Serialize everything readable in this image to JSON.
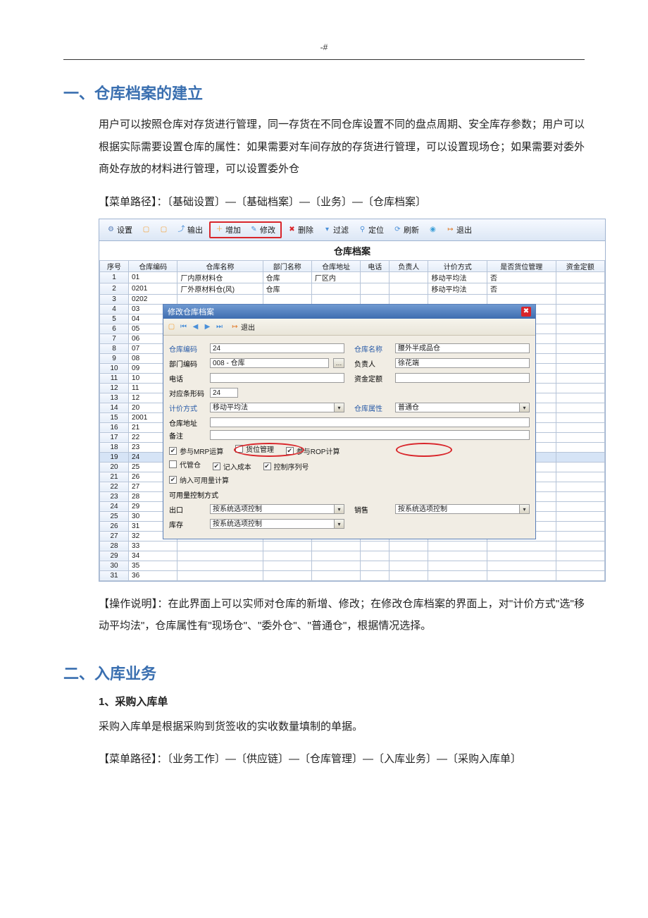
{
  "page_mark": "-#",
  "heading1": "一、仓库档案的建立",
  "para1": "用户可以按照仓库对存货进行管理，同一存货在不同仓库设置不同的盘点周期、安全库存参数；用户可以根据实际需要设置仓库的属性：如果需要对车间存放的存货进行管理，可以设置现场仓；如果需要对委外商处存放的材料进行管理，可以设置委外仓",
  "menu_path1": "【菜单路径】：〔基础设置〕—〔基础档案〕—〔业务〕—〔仓库档案〕",
  "op_note": "【操作说明】：在此界面上可以实师对仓库的新增、修改；在修改仓库档案的界面上，对\"计价方式\"选\"移动平均法\"，仓库属性有\"现场仓\"、\"委外仓\"、\"普通仓\"，根据情况选择。",
  "heading2": "二、入库业务",
  "sub2_1": "1、采购入库单",
  "para2": "采购入库单是根据采购到货签收的实收数量填制的单据。",
  "menu_path2": "【菜单路径】：〔业务工作〕—〔供应链〕—〔仓库管理〕—〔入库业务〕—〔采购入库单〕",
  "shot": {
    "toolbar": {
      "settings": "设置",
      "blank1": "",
      "blank2": "",
      "output": "输出",
      "add": "增加",
      "modify": "修改",
      "delete": "删除",
      "filter": "过滤",
      "locate": "定位",
      "refresh": "刷新",
      "ok": "",
      "exit": "退出"
    },
    "title": "仓库档案",
    "cols": [
      "序号",
      "仓库编码",
      "仓库名称",
      "部门名称",
      "仓库地址",
      "电话",
      "负责人",
      "计价方式",
      "是否货位管理",
      "资金定额"
    ],
    "rows": [
      [
        "1",
        "01",
        "厂内原材料仓",
        "仓库",
        "厂区内",
        "",
        "",
        "移动平均法",
        "否",
        ""
      ],
      [
        "2",
        "0201",
        "厂外原材料仓(风)",
        "仓库",
        "",
        "",
        "",
        "移动平均法",
        "否",
        ""
      ],
      [
        "3",
        "0202",
        "",
        "",
        "",
        "",
        "",
        "",
        "",
        ""
      ],
      [
        "4",
        "03",
        "",
        "",
        "",
        "",
        "",
        "",
        "",
        ""
      ],
      [
        "5",
        "04",
        "",
        "",
        "",
        "",
        "",
        "",
        "",
        ""
      ],
      [
        "6",
        "05",
        "",
        "",
        "",
        "",
        "",
        "",
        "",
        ""
      ],
      [
        "7",
        "06",
        "",
        "",
        "",
        "",
        "",
        "",
        "",
        ""
      ],
      [
        "8",
        "07",
        "",
        "",
        "",
        "",
        "",
        "",
        "",
        ""
      ],
      [
        "9",
        "08",
        "",
        "",
        "",
        "",
        "",
        "",
        "",
        ""
      ],
      [
        "10",
        "09",
        "",
        "",
        "",
        "",
        "",
        "",
        "",
        ""
      ],
      [
        "11",
        "10",
        "",
        "",
        "",
        "",
        "",
        "",
        "",
        ""
      ],
      [
        "12",
        "11",
        "",
        "",
        "",
        "",
        "",
        "",
        "",
        ""
      ],
      [
        "13",
        "12",
        "",
        "",
        "",
        "",
        "",
        "",
        "",
        ""
      ],
      [
        "14",
        "20",
        "",
        "",
        "",
        "",
        "",
        "",
        "",
        ""
      ],
      [
        "15",
        "2001",
        "",
        "",
        "",
        "",
        "",
        "",
        "",
        ""
      ],
      [
        "16",
        "21",
        "",
        "",
        "",
        "",
        "",
        "",
        "",
        ""
      ],
      [
        "17",
        "22",
        "",
        "",
        "",
        "",
        "",
        "",
        "",
        ""
      ],
      [
        "18",
        "23",
        "",
        "",
        "",
        "",
        "",
        "",
        "",
        ""
      ],
      [
        "19",
        "24",
        "",
        "",
        "",
        "",
        "",
        "",
        "",
        ""
      ],
      [
        "20",
        "25",
        "",
        "",
        "",
        "",
        "",
        "",
        "",
        ""
      ],
      [
        "21",
        "26",
        "",
        "",
        "",
        "",
        "",
        "",
        "",
        ""
      ],
      [
        "22",
        "27",
        "",
        "",
        "",
        "",
        "",
        "",
        "",
        ""
      ],
      [
        "23",
        "28",
        "",
        "",
        "",
        "",
        "",
        "",
        "",
        ""
      ],
      [
        "24",
        "29",
        "",
        "",
        "",
        "",
        "",
        "",
        "",
        ""
      ],
      [
        "25",
        "30",
        "",
        "",
        "",
        "",
        "",
        "",
        "",
        ""
      ],
      [
        "26",
        "31",
        "",
        "",
        "",
        "",
        "",
        "",
        "",
        ""
      ],
      [
        "27",
        "32",
        "",
        "",
        "",
        "",
        "",
        "",
        "",
        ""
      ],
      [
        "28",
        "33",
        "",
        "",
        "",
        "",
        "",
        "",
        "",
        ""
      ],
      [
        "29",
        "34",
        "",
        "",
        "",
        "",
        "",
        "",
        "",
        ""
      ],
      [
        "30",
        "35",
        "",
        "",
        "",
        "",
        "",
        "",
        "",
        ""
      ],
      [
        "31",
        "36",
        "",
        "",
        "",
        "",
        "",
        "",
        "",
        ""
      ]
    ],
    "right_marks": [
      "01",
      "020",
      "020",
      "03",
      "04",
      "05",
      "06",
      "07",
      "08",
      "09",
      "10",
      "11",
      "12",
      "20",
      "200",
      "21",
      "22",
      "23",
      "24",
      "25",
      "26",
      "27",
      "28",
      "29",
      "30",
      "31",
      "32",
      "33",
      "34",
      "35",
      "36"
    ],
    "dialog": {
      "title": "修改仓库档案",
      "tb_exit": "退出",
      "labels": {
        "code": "仓库编码",
        "name": "仓库名称",
        "dept": "部门编码",
        "person": "负责人",
        "phone": "电话",
        "fund": "资金定额",
        "barcode": "对应条形码",
        "pricing": "计价方式",
        "prop": "仓库属性",
        "addr": "仓库地址",
        "remark": "备注",
        "export": "出口",
        "sales": "销售",
        "stock": "库存"
      },
      "values": {
        "code": "24",
        "name": "腰外半成品仓",
        "dept": "008 - 仓库",
        "person": "徐花端",
        "phone": "",
        "fund": "",
        "barcode": "24",
        "pricing": "移动平均法",
        "prop": "普通仓",
        "addr": "",
        "remark": "",
        "export": "按系统选项控制",
        "sales": "按系统选项控制",
        "stock": "按系统选项控制"
      },
      "checks": {
        "mrp": "参与MRP运算",
        "bin": "货位管理",
        "rop": "参与ROP计算",
        "agent": "代管仓",
        "cost": "记入成本",
        "serial": "控制序列号",
        "avail": "纳入可用量计算",
        "method": "可用量控制方式"
      },
      "states": {
        "mrp": true,
        "bin": false,
        "rop": true,
        "agent": false,
        "cost": true,
        "serial": true,
        "avail": true
      }
    }
  }
}
